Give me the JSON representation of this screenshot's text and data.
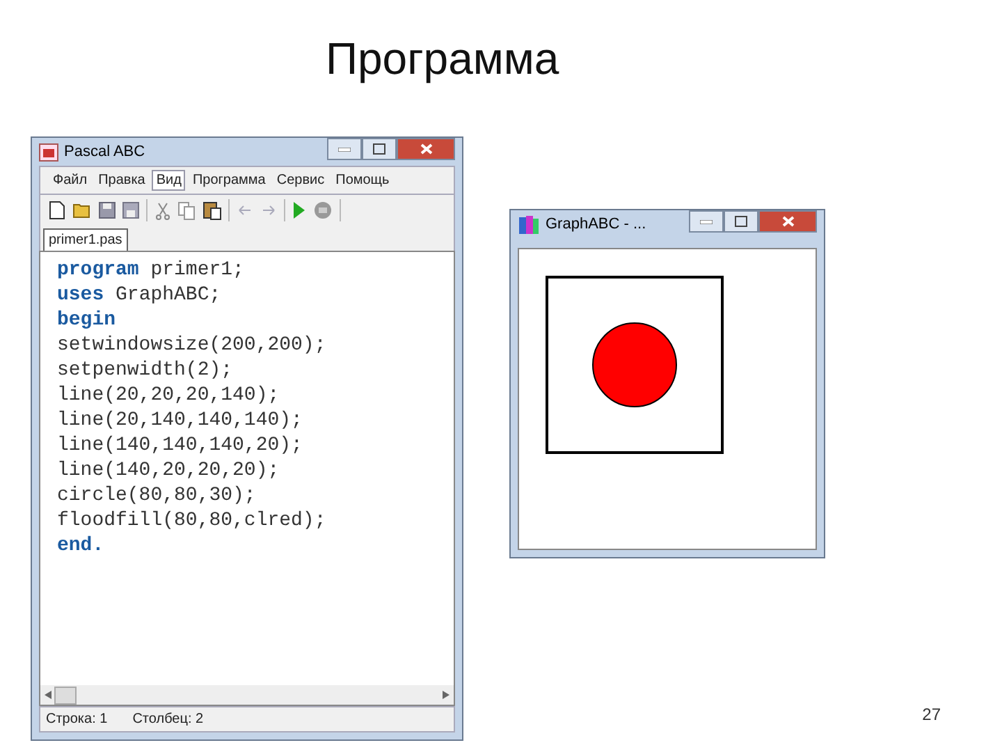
{
  "slide": {
    "title": "Программа",
    "page_number": "27"
  },
  "editor_window": {
    "title": "Pascal ABC",
    "menu": [
      {
        "label": "Файл",
        "selected": false
      },
      {
        "label": "Правка",
        "selected": false
      },
      {
        "label": "Вид",
        "selected": true
      },
      {
        "label": "Программа",
        "selected": false
      },
      {
        "label": "Сервис",
        "selected": false
      },
      {
        "label": "Помощь",
        "selected": false
      }
    ],
    "tabs": [
      {
        "label": "primer1.pas",
        "selected": true
      }
    ],
    "code_lines": [
      [
        {
          "text": "program",
          "kind": "keyword"
        },
        {
          "text": " primer1;",
          "kind": "plain"
        }
      ],
      [
        {
          "text": "uses",
          "kind": "keyword"
        },
        {
          "text": " GraphABC;",
          "kind": "plain"
        }
      ],
      [
        {
          "text": "begin",
          "kind": "keyword"
        }
      ],
      [
        {
          "text": "setwindowsize(200,200);",
          "kind": "plain"
        }
      ],
      [
        {
          "text": "setpenwidth(2);",
          "kind": "plain"
        }
      ],
      [
        {
          "text": "line(20,20,20,140);",
          "kind": "plain"
        }
      ],
      [
        {
          "text": "line(20,140,140,140);",
          "kind": "plain"
        }
      ],
      [
        {
          "text": "line(140,140,140,20);",
          "kind": "plain"
        }
      ],
      [
        {
          "text": "line(140,20,20,20);",
          "kind": "plain"
        }
      ],
      [
        {
          "text": "circle(80,80,30);",
          "kind": "plain"
        }
      ],
      [
        {
          "text": "floodfill(80,80,clred);",
          "kind": "plain"
        }
      ],
      [
        {
          "text": "end.",
          "kind": "keyword"
        }
      ]
    ],
    "status_bar": [
      "Строка: 1",
      "Столбец: 2"
    ]
  },
  "graph_window": {
    "title": "GraphABC - ..."
  }
}
